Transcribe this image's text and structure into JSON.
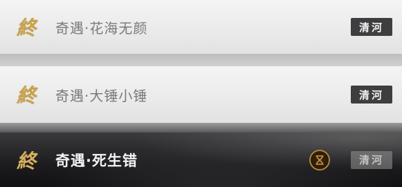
{
  "entries": [
    {
      "mark": "終",
      "title": "奇遇·花海无颜",
      "tag": "清河",
      "selected": false
    },
    {
      "mark": "終",
      "title": "奇遇·大锤小锤",
      "tag": "清河",
      "selected": false
    },
    {
      "mark": "終",
      "title": "奇遇·死生错",
      "tag": "清河",
      "selected": true
    }
  ],
  "colors": {
    "mark_gold": "#c9a24a",
    "tag_bg": "#3e3e40",
    "selected_row_bg": "#1c1c1e",
    "emblem_ring": "#b8832e"
  },
  "icons": {
    "row_emblem": "hourglass-icon"
  }
}
